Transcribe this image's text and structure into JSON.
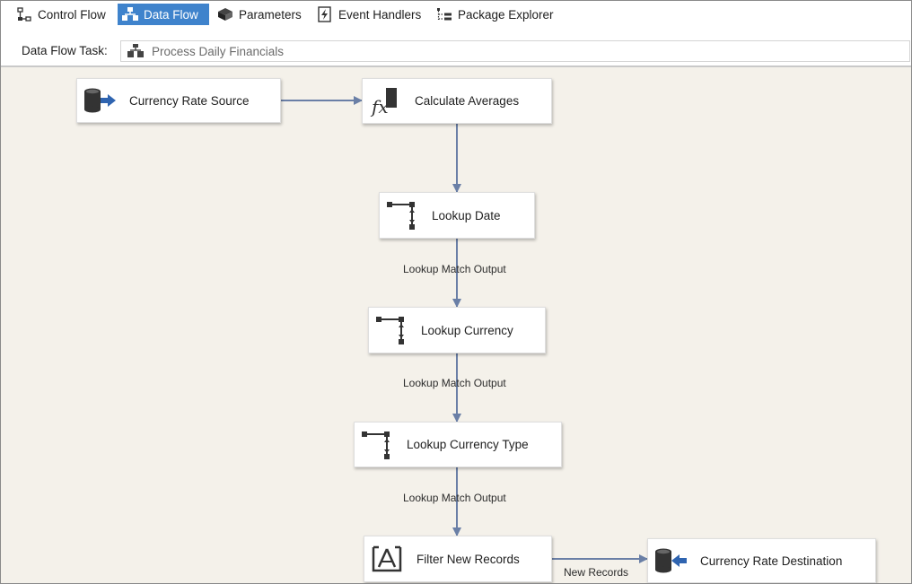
{
  "tabs": [
    {
      "label": "Control Flow",
      "icon": "control-flow-icon",
      "active": false
    },
    {
      "label": "Data Flow",
      "icon": "data-flow-icon",
      "active": true
    },
    {
      "label": "Parameters",
      "icon": "parameters-icon",
      "active": false
    },
    {
      "label": "Event Handlers",
      "icon": "event-handlers-icon",
      "active": false
    },
    {
      "label": "Package Explorer",
      "icon": "package-explorer-icon",
      "active": false
    }
  ],
  "task": {
    "label": "Data Flow Task:",
    "selected": "Process Daily Financials"
  },
  "nodes": {
    "currency_rate_source": {
      "label": "Currency Rate Source",
      "icon": "source-icon"
    },
    "calculate_averages": {
      "label": "Calculate Averages",
      "icon": "derived-column-icon"
    },
    "lookup_date": {
      "label": "Lookup Date",
      "icon": "lookup-icon"
    },
    "lookup_currency": {
      "label": "Lookup Currency",
      "icon": "lookup-icon"
    },
    "lookup_currency_type": {
      "label": "Lookup Currency Type",
      "icon": "lookup-icon"
    },
    "filter_new_records": {
      "label": "Filter New Records",
      "icon": "conditional-split-icon"
    },
    "currency_rate_destination": {
      "label": "Currency Rate Destination",
      "icon": "destination-icon"
    }
  },
  "path_labels": {
    "lookup_date_out": "Lookup Match Output",
    "lookup_currency_out": "Lookup Match Output",
    "lookup_currency_type_out": "Lookup Match Output",
    "filter_out": "New Records"
  },
  "colors": {
    "active_tab": "#3f83cc",
    "canvas": "#f4f1ea",
    "connector": "#6a7fa6"
  }
}
